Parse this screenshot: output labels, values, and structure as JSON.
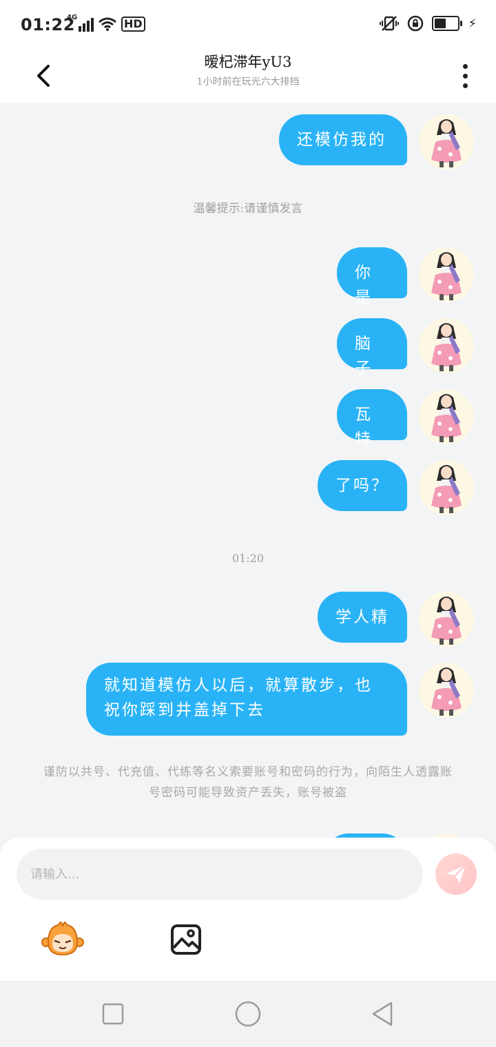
{
  "status_bar": {
    "time": "01:22",
    "network": "4G",
    "hd": "HD"
  },
  "header": {
    "title": "暧杞滞年yU3",
    "subtitle": "1小时前在玩光六大排挡"
  },
  "messages": [
    {
      "text": "还模仿我的"
    },
    {
      "text": "你是"
    },
    {
      "text": "脑子"
    },
    {
      "text": "瓦特"
    },
    {
      "text": "了吗？"
    },
    {
      "text": "学人精"
    },
    {
      "text": "就知道模仿人以后，就算散步，也祝你踩到井盖掉下去"
    }
  ],
  "system": {
    "tip": "温馨提示:请谨慎发言",
    "timestamp": "01:20",
    "warning": "谨防以共号、代充值、代练等名义索要账号和密码的行为，向陌生人透露账号密码可能导致资产丢失，账号被盗"
  },
  "input": {
    "placeholder": "请输入..."
  },
  "icons": {
    "back": "back-arrow-icon",
    "more": "more-vertical-icon",
    "send": "send-icon",
    "emoji": "emoji-mascot-icon",
    "image": "image-icon",
    "nav_recent": "square-icon",
    "nav_home": "circle-icon",
    "nav_back": "triangle-back-icon"
  },
  "colors": {
    "bubble": "#29b3f6",
    "background": "#f3f4f6",
    "send": "#ffc4c9"
  }
}
